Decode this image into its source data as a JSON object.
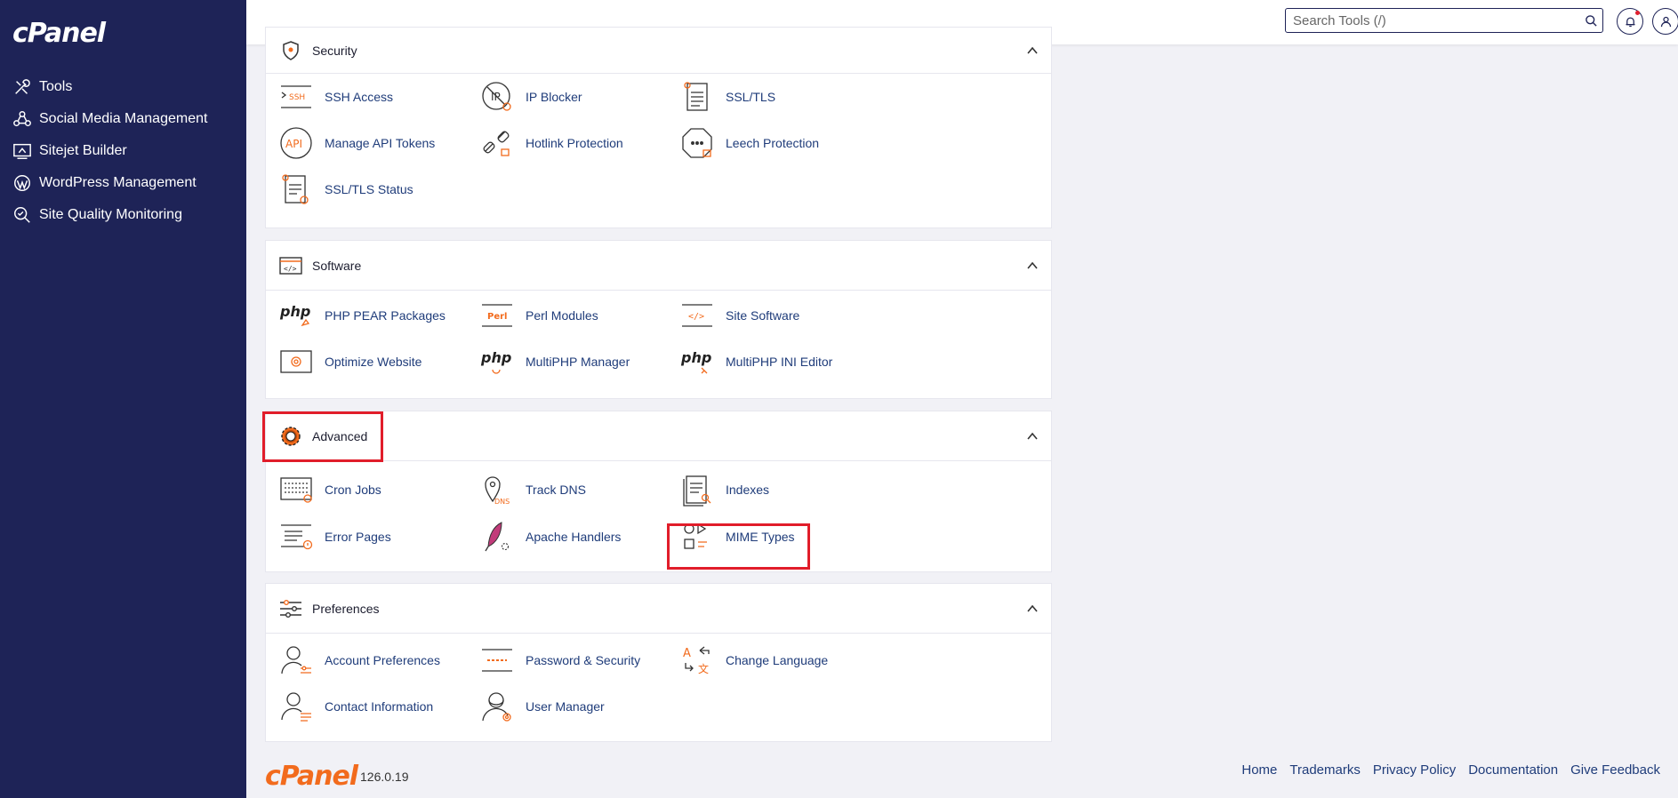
{
  "brand": {
    "logo_text": "cPanel",
    "version": "126.0.19"
  },
  "sidebar": {
    "items": [
      {
        "label": "Tools",
        "icon": "tools-icon"
      },
      {
        "label": "Social Media Management",
        "icon": "social-media-icon"
      },
      {
        "label": "Sitejet Builder",
        "icon": "sitejet-icon"
      },
      {
        "label": "WordPress Management",
        "icon": "wordpress-icon"
      },
      {
        "label": "Site Quality Monitoring",
        "icon": "site-quality-icon"
      }
    ]
  },
  "topbar": {
    "search_placeholder": "Search Tools (/)"
  },
  "sections": {
    "security": {
      "title": "Security",
      "items": [
        "SSH Access",
        "IP Blocker",
        "SSL/TLS",
        "Manage API Tokens",
        "Hotlink Protection",
        "Leech Protection",
        "SSL/TLS Status"
      ]
    },
    "software": {
      "title": "Software",
      "items": [
        "PHP PEAR Packages",
        "Perl Modules",
        "Site Software",
        "Optimize Website",
        "MultiPHP Manager",
        "MultiPHP INI Editor"
      ]
    },
    "advanced": {
      "title": "Advanced",
      "items": [
        "Cron Jobs",
        "Track DNS",
        "Indexes",
        "Error Pages",
        "Apache Handlers",
        "MIME Types"
      ]
    },
    "preferences": {
      "title": "Preferences",
      "items": [
        "Account Preferences",
        "Password & Security",
        "Change Language",
        "Contact Information",
        "User Manager"
      ]
    }
  },
  "footer": {
    "links": [
      "Home",
      "Trademarks",
      "Privacy Policy",
      "Documentation",
      "Give Feedback"
    ]
  },
  "colors": {
    "sidebar": "#1e2357",
    "accent": "#f26b1d",
    "link": "#1f3c7a",
    "highlight": "#e11d2a"
  }
}
